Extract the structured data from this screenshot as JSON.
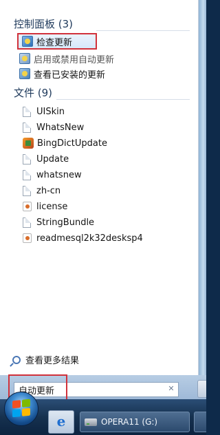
{
  "start_menu": {
    "control_panel": {
      "title": "控制面板 (3)",
      "items": [
        {
          "label": "检查更新",
          "icon": "windows-update-icon",
          "selected": true
        },
        {
          "label": "启用或禁用自动更新",
          "icon": "windows-update-settings-icon",
          "selected": false
        },
        {
          "label": "查看已安装的更新",
          "icon": "installed-updates-icon",
          "selected": false
        }
      ]
    },
    "files": {
      "title": "文件 (9)",
      "items": [
        {
          "label": "UISkin",
          "icon": "document-icon"
        },
        {
          "label": "WhatsNew",
          "icon": "document-icon"
        },
        {
          "label": "BingDictUpdate",
          "icon": "application-icon"
        },
        {
          "label": "Update",
          "icon": "document-icon"
        },
        {
          "label": "whatsnew",
          "icon": "document-icon"
        },
        {
          "label": "zh-cn",
          "icon": "document-icon"
        },
        {
          "label": "license",
          "icon": "resource-file-icon"
        },
        {
          "label": "StringBundle",
          "icon": "document-icon"
        },
        {
          "label": "readmesql2k32desksp4",
          "icon": "resource-file-icon"
        }
      ]
    },
    "see_more": {
      "label": "查看更多结果",
      "icon": "search-icon"
    },
    "search": {
      "value": "自动更新",
      "clear_icon": "clear-x-icon"
    }
  },
  "taskbar": {
    "start_button_icon": "windows-start-orb-icon",
    "pinned": [
      {
        "icon": "internet-explorer-icon"
      }
    ],
    "drive_button": {
      "label": "OPERA11 (G:)",
      "icon": "removable-drive-icon"
    }
  },
  "colors": {
    "highlight_border": "#d1313a",
    "group_title": "#1e395b",
    "taskbar": "#16314f"
  }
}
